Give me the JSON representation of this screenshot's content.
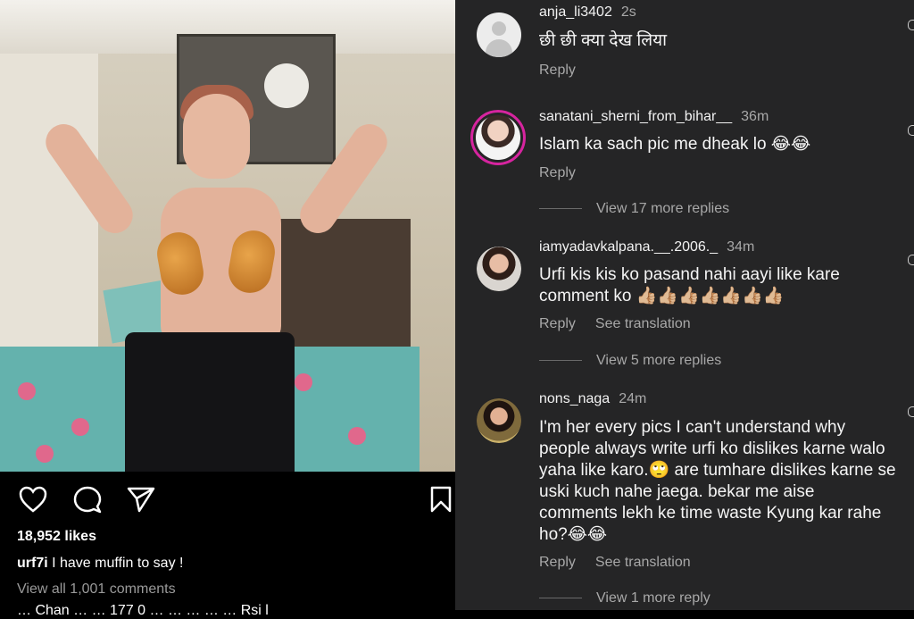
{
  "post": {
    "likes": "18,952 likes",
    "caption_user": "urf7i",
    "caption_text": " I have muffin to say !",
    "view_all": "View all 1,001 comments",
    "cut_text": "… Chan … … 177 0 … … … … … Rsi l"
  },
  "icons": {
    "like": "heart-outline-icon",
    "comment": "speech-bubble-icon",
    "share": "paper-plane-icon",
    "save": "bookmark-icon"
  },
  "comments": [
    {
      "user": "anja_li3402",
      "time": "2s",
      "text": "छी छी क्या देख लिया",
      "reply": "Reply"
    },
    {
      "user": "sanatani_sherni_from_bihar__",
      "time": "36m",
      "text": "Islam ka sach pic me dheak lo 😂😂",
      "reply": "Reply",
      "more_replies": "View 17 more replies"
    },
    {
      "user": "iamyadavkalpana.__.2006._",
      "time": "34m",
      "text": "Urfi kis kis ko pasand nahi aayi like kare comment ko 👍🏼👍🏼👍🏼👍🏼👍🏼👍🏼👍🏼",
      "reply": "Reply",
      "translate": "See translation",
      "more_replies": "View 5 more replies"
    },
    {
      "user": "nons_naga",
      "time": "24m",
      "text": "I'm her every pics I can't understand why people always write urfi ko dislikes karne walo yaha like karo.🙄 are tumhare dislikes karne se uski kuch nahe jaega. bekar me aise comments lekh ke time waste Kyung kar rahe ho?😂😂",
      "reply": "Reply",
      "translate": "See translation",
      "more_replies": "View 1 more reply"
    }
  ]
}
